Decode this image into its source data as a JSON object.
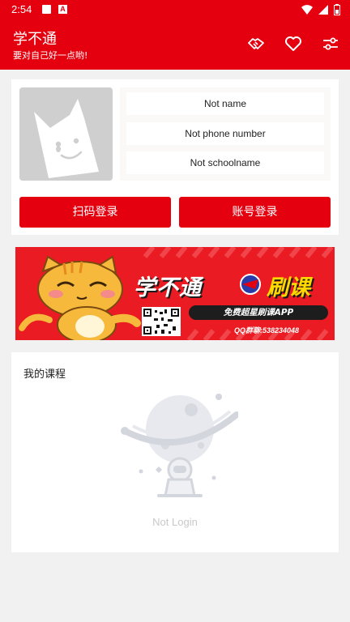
{
  "status_bar": {
    "time": "2:54",
    "icons": [
      "square-notification-icon",
      "a-notification-icon",
      "wifi-icon",
      "signal-icon",
      "battery-icon"
    ]
  },
  "app_bar": {
    "title": "学不通",
    "subtitle": "要对自己好一点哟!",
    "actions": [
      "handshake-icon",
      "heart-icon",
      "settings-sliders-icon"
    ],
    "color": "#e4000f"
  },
  "profile": {
    "name": "Not name",
    "phone": "Not phone number",
    "school": "Not schoolname",
    "scan_login_label": "扫码登录",
    "account_login_label": "账号登录"
  },
  "banner": {
    "title_main": "学不通",
    "title_accent": "刷课",
    "tagline": "免费超星刷课APP",
    "qq_group": "QQ群聊:538234048"
  },
  "courses": {
    "title": "我的课程",
    "empty_text": "Not Login"
  }
}
